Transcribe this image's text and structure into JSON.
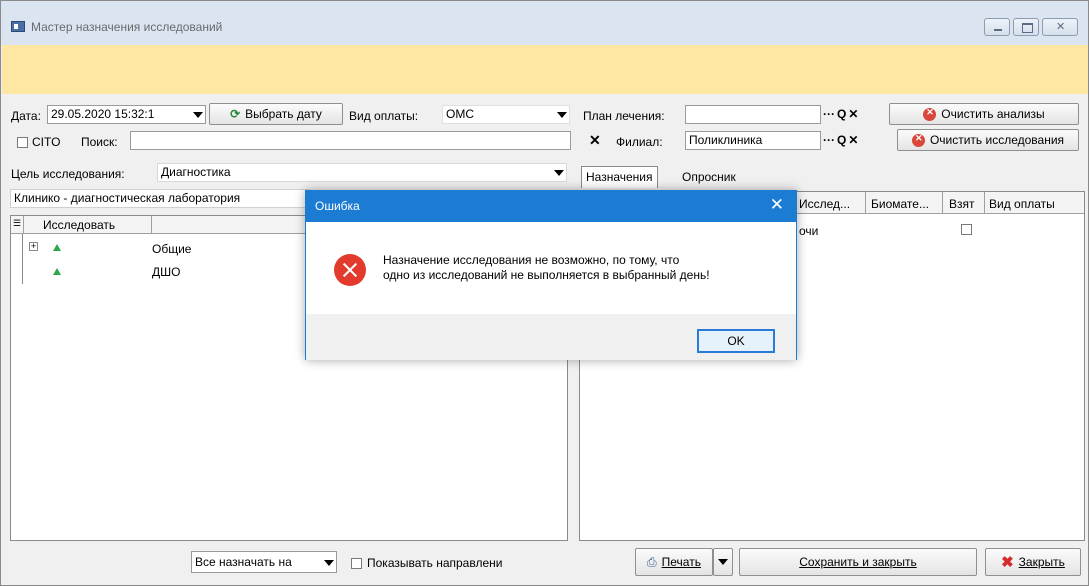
{
  "window": {
    "title": "Мастер назначения исследований"
  },
  "toolbar": {
    "date_label": "Дата:",
    "date_value": "29.05.2020 15:32:1",
    "pick_date_button": "Выбрать дату",
    "payment_label": "Вид оплаты:",
    "payment_value": "ОМС",
    "plan_label": "План лечения:",
    "plan_value": "",
    "clear_analyses_button": "Очистить анализы",
    "cito_label": "CITO",
    "search_label": "Поиск:",
    "search_value": "",
    "branch_label": "Филиал:",
    "branch_value": "Поликлиника",
    "clear_research_button": "Очистить исследования",
    "purpose_label": "Цель исследования:",
    "purpose_value": "Диагностика",
    "lab_value": "Клинико - диагностическая лаборатория"
  },
  "left_grid": {
    "columns": [
      "Исследовать"
    ],
    "rows": [
      {
        "label": "Общие"
      },
      {
        "label": "ДШО"
      }
    ]
  },
  "right_panel": {
    "tabs": [
      "Назначения",
      "Опросник"
    ],
    "columns": [
      "Исслед...",
      "Биомате...",
      "Взят",
      "Вид оплаты"
    ],
    "row_fragment": "очи"
  },
  "bottom": {
    "assign_all_value": "Все назначать на",
    "show_directions_label": "Показывать направлени",
    "print_button": "Печать",
    "save_close_button": "Сохранить и закрыть",
    "close_button": "Закрыть"
  },
  "dialog": {
    "title": "Ошибка",
    "message_line1": "Назначение исследования не возможно, по тому, что",
    "message_line2": "одно из исследований не выполняется в выбранный день!",
    "ok_button": "OK"
  },
  "colors": {
    "accent": "#1c7bd2",
    "banner": "#fde7a3",
    "error": "#e23b2e"
  }
}
